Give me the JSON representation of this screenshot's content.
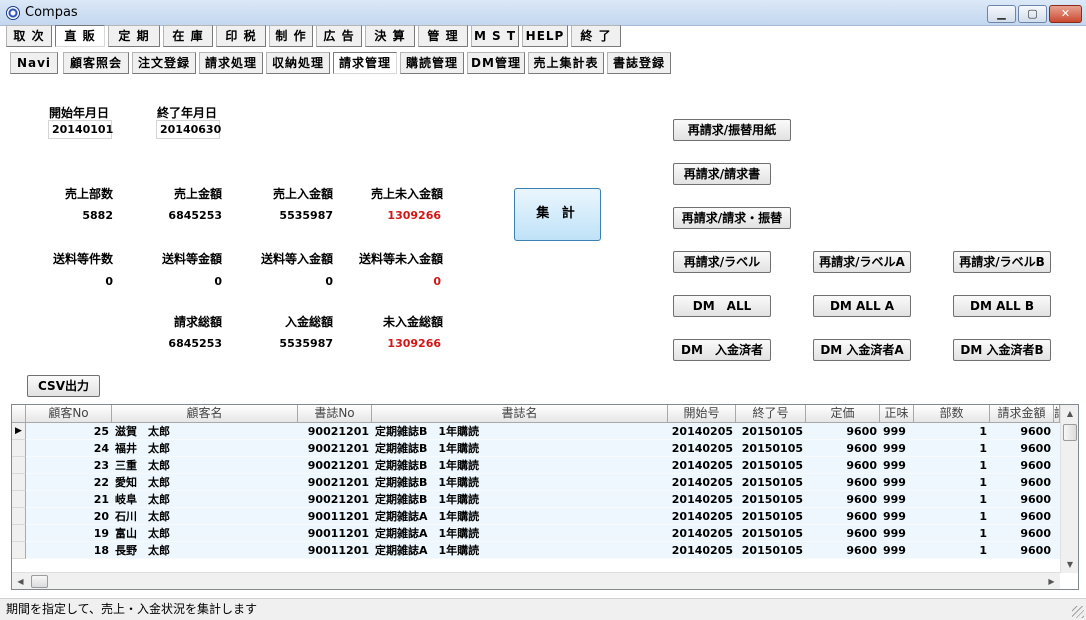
{
  "window": {
    "title": "Compas",
    "min_glyph": "▁",
    "max_glyph": "▢",
    "close_glyph": "✕"
  },
  "menu": [
    "取 次",
    "直 販",
    "定 期",
    "在 庫",
    "印 税",
    "制 作",
    "広 告",
    "決 算",
    "管 理",
    "M S T",
    "HELP",
    "終 了"
  ],
  "submenu": [
    "Navi",
    "顧客照会",
    "注文登録",
    "請求処理",
    "収納処理",
    "請求管理",
    "購読管理",
    "DM管理",
    "売上集計表",
    "書誌登録"
  ],
  "period": {
    "start_label": "開始年月日",
    "start_value": "20140101",
    "end_label": "終了年月日",
    "end_value": "20140630"
  },
  "sales": {
    "labels": [
      "売上部数",
      "売上金額",
      "売上入金額",
      "売上未入金額"
    ],
    "values": [
      "5882",
      "6845253",
      "5535987",
      "1309266"
    ]
  },
  "shipping": {
    "labels": [
      "送料等件数",
      "送料等金額",
      "送料等入金額",
      "送料等未入金額"
    ],
    "values": [
      "0",
      "0",
      "0",
      "0"
    ]
  },
  "totals": {
    "labels": [
      "請求総額",
      "入金総額",
      "未入金総額"
    ],
    "values": [
      "6845253",
      "5535987",
      "1309266"
    ]
  },
  "aggregate_button": "集 計",
  "csv_button": "CSV出力",
  "rebill_buttons": [
    "再請求/振替用紙",
    "再請求/請求書",
    "再請求/請求・振替"
  ],
  "label_buttons": [
    "再請求/ラベル",
    "再請求/ラベルA",
    "再請求/ラベルB"
  ],
  "dm_all_buttons": [
    "DM　ALL",
    "DM ALL A",
    "DM ALL B"
  ],
  "dm_paid_buttons": [
    "DM　入金済者",
    "DM 入金済者A",
    "DM 入金済者B"
  ],
  "grid": {
    "columns": [
      "顧客No",
      "顧客名",
      "書誌No",
      "書誌名",
      "開始号",
      "終了号",
      "定価",
      "正味",
      "部数",
      "請求金額",
      "請"
    ],
    "current_row_marker": "▶",
    "rows": [
      [
        "25",
        "滋賀　太郎",
        "90021201",
        "定期雑誌B　1年購読",
        "20140205",
        "20150105",
        "9600",
        "999",
        "1",
        "9600"
      ],
      [
        "24",
        "福井　太郎",
        "90021201",
        "定期雑誌B　1年購読",
        "20140205",
        "20150105",
        "9600",
        "999",
        "1",
        "9600"
      ],
      [
        "23",
        "三重　太郎",
        "90021201",
        "定期雑誌B　1年購読",
        "20140205",
        "20150105",
        "9600",
        "999",
        "1",
        "9600"
      ],
      [
        "22",
        "愛知　太郎",
        "90021201",
        "定期雑誌B　1年購読",
        "20140205",
        "20150105",
        "9600",
        "999",
        "1",
        "9600"
      ],
      [
        "21",
        "岐阜　太郎",
        "90021201",
        "定期雑誌B　1年購読",
        "20140205",
        "20150105",
        "9600",
        "999",
        "1",
        "9600"
      ],
      [
        "20",
        "石川　太郎",
        "90011201",
        "定期雑誌A　1年購読",
        "20140205",
        "20150105",
        "9600",
        "999",
        "1",
        "9600"
      ],
      [
        "19",
        "富山　太郎",
        "90011201",
        "定期雑誌A　1年購読",
        "20140205",
        "20150105",
        "9600",
        "999",
        "1",
        "9600"
      ],
      [
        "18",
        "長野　太郎",
        "90011201",
        "定期雑誌A　1年購読",
        "20140205",
        "20150105",
        "9600",
        "999",
        "1",
        "9600"
      ]
    ]
  },
  "scroll": {
    "up": "▲",
    "down": "▼",
    "left": "◀",
    "right": "▶"
  },
  "status": "期間を指定して、売上・入金状況を集計します",
  "colors": {
    "unpaid_red": "#d21616",
    "accent_blue": "#3c7fb1"
  }
}
